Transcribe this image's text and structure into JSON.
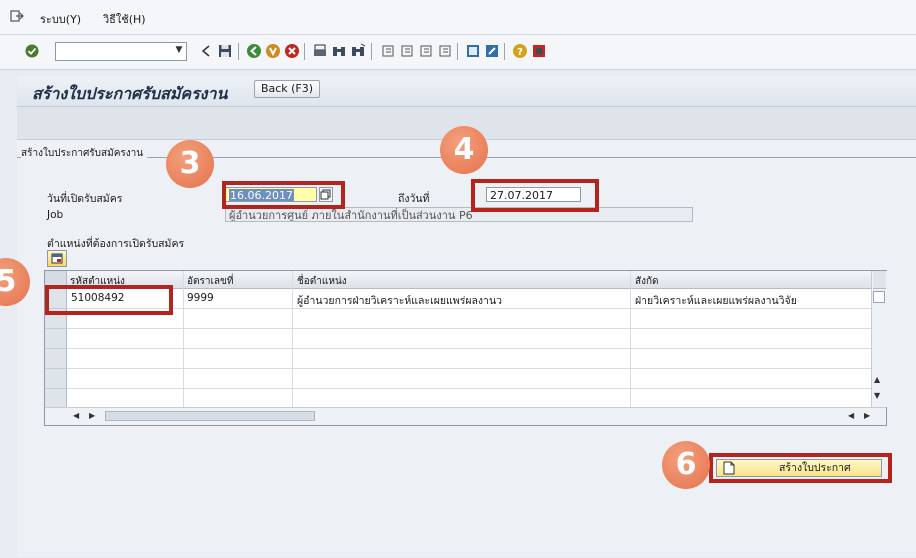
{
  "menu": {
    "items": [
      {
        "label": "ระบบ(Y)"
      },
      {
        "label": "วิธีใช้(H)"
      }
    ]
  },
  "toolbar": {
    "command_value": "",
    "icons": [
      "check-icon",
      "back-arrow-icon",
      "save-icon",
      "back-green-icon",
      "exit-icon",
      "cancel-icon",
      "print-icon",
      "find-icon",
      "find-next-icon",
      "first-page-icon",
      "prev-page-icon",
      "next-page-icon",
      "last-page-icon",
      "create-session-icon",
      "shortcut-icon",
      "help-icon",
      "customize-layout-icon"
    ]
  },
  "title": {
    "page_title": "สร้างใบประกาศรับสมัครงาน",
    "back_button": "Back  (F3)"
  },
  "group": {
    "title": "สร้างใบประกาศรับสมัครงาน"
  },
  "form": {
    "open_date_label": "วันที่เปิดรับสมัคร",
    "open_date_value": "16.06.2017",
    "to_date_label": "ถึงวันที่",
    "to_date_value": "27.07.2017",
    "job_label": "Job",
    "job_value": "ผู้อำนวยการศูนย์ ภายในสำนักงานที่เป็นส่วนงาน P6",
    "positions_label": "ตำแหน่งที่ต้องการเปิดรับสมัคร"
  },
  "table": {
    "columns": [
      "รหัสตำแหน่ง",
      "อัตราเลขที่",
      "ชื่อตำแหน่ง",
      "สังกัด"
    ],
    "rows": [
      [
        "51008492",
        "9999",
        "ผู้อำนวยการฝ่ายวิเคราะห์และเผยแพร่ผลงานว",
        "ฝ่ายวิเคราะห์และเผยแพร่ผลงานวิจัย"
      ]
    ]
  },
  "create_button": {
    "label": "สร้างใบประกาศ"
  },
  "steps": {
    "s3": "3",
    "s4": "4",
    "s5": "5",
    "s6": "6"
  },
  "colors": {
    "highlight": "#b4231c",
    "badge": "#e5724c",
    "button_yellow": "#f6e487"
  }
}
